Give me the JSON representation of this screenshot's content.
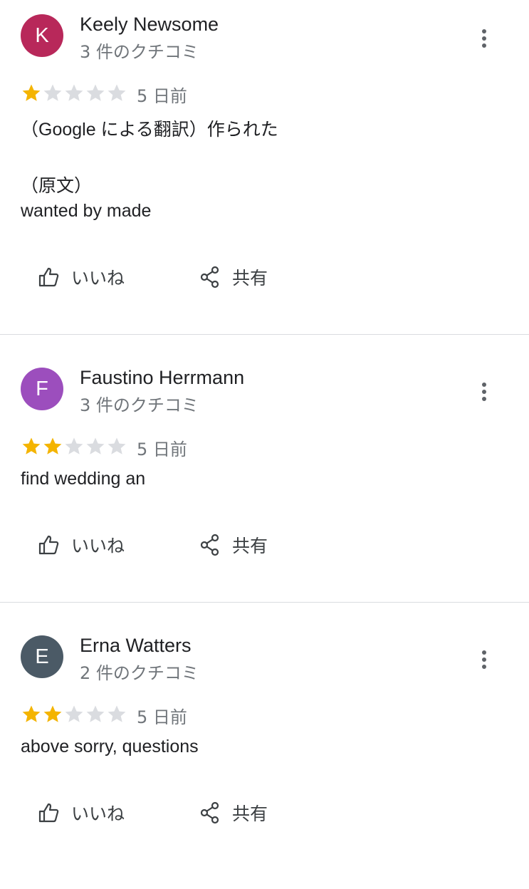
{
  "colors": {
    "star_filled": "#f4b400",
    "star_empty": "#dadce0",
    "secondary_text": "#70757a"
  },
  "reviews": [
    {
      "avatar_letter": "K",
      "avatar_color": "#b8285a",
      "author": "Keely Newsome",
      "review_count": "3 件のクチコミ",
      "rating": 1,
      "max_rating": 5,
      "date": "5 日前",
      "lines": [
        "（Google による翻訳）作られた",
        "（原文）",
        "wanted by made"
      ],
      "like_label": "いいね",
      "share_label": "共有",
      "more_icon": "more-vert-icon"
    },
    {
      "avatar_letter": "F",
      "avatar_color": "#9c4ebd",
      "author": "Faustino Herrmann",
      "review_count": "3 件のクチコミ",
      "rating": 2,
      "max_rating": 5,
      "date": "5 日前",
      "lines": [
        "find wedding an"
      ],
      "like_label": "いいね",
      "share_label": "共有",
      "more_icon": "more-vert-icon"
    },
    {
      "avatar_letter": "E",
      "avatar_color": "#4b5a66",
      "author": "Erna Watters",
      "review_count": "2 件のクチコミ",
      "rating": 2,
      "max_rating": 5,
      "date": "5 日前",
      "lines": [
        "above sorry, questions"
      ],
      "like_label": "いいね",
      "share_label": "共有",
      "more_icon": "more-vert-icon"
    }
  ]
}
